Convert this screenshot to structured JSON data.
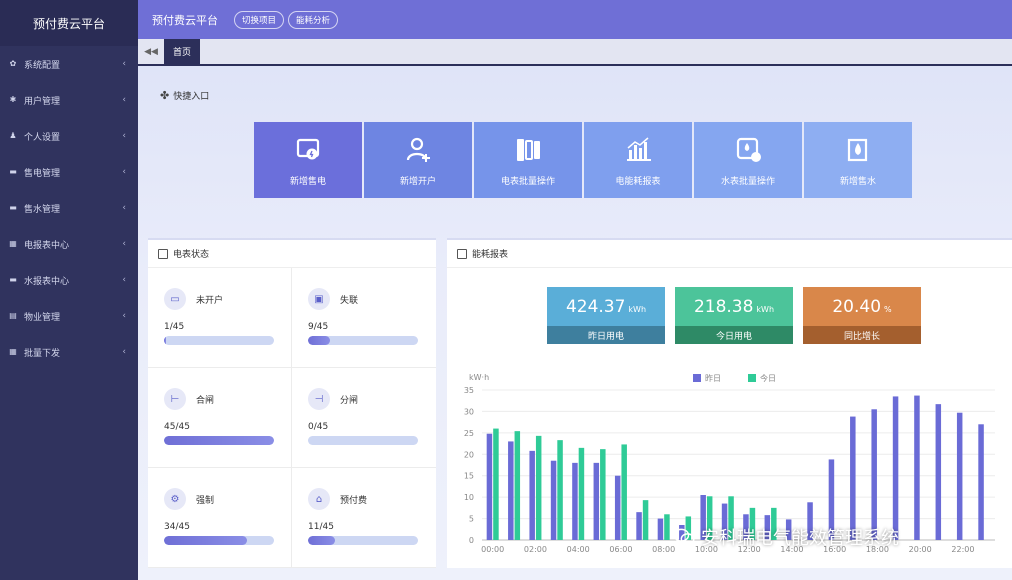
{
  "app": {
    "brand": "预付费云平台"
  },
  "header": {
    "title": "预付费云平台",
    "buttons": [
      "切换项目",
      "能耗分析"
    ]
  },
  "sidebar": {
    "items": [
      {
        "label": "系统配置",
        "icon": "gear-icon"
      },
      {
        "label": "用户管理",
        "icon": "asterisk-icon"
      },
      {
        "label": "个人设置",
        "icon": "person-icon"
      },
      {
        "label": "售电管理",
        "icon": "folder-icon"
      },
      {
        "label": "售水管理",
        "icon": "folder-icon"
      },
      {
        "label": "电报表中心",
        "icon": "grid-icon"
      },
      {
        "label": "水报表中心",
        "icon": "folder-icon"
      },
      {
        "label": "物业管理",
        "icon": "calendar-icon"
      },
      {
        "label": "批量下发",
        "icon": "grid-icon"
      }
    ]
  },
  "tabs": {
    "home": "首页"
  },
  "quick": {
    "title": "快捷入口",
    "cards": [
      {
        "label": "新增售电",
        "icon": "electric-sale-icon",
        "color": "#6b6fdb"
      },
      {
        "label": "新增开户",
        "icon": "add-user-icon",
        "color": "#6e85e2"
      },
      {
        "label": "电表批量操作",
        "icon": "meter-batch-icon",
        "color": "#7694ea"
      },
      {
        "label": "电能耗报表",
        "icon": "bar-report-icon",
        "color": "#7f9fee"
      },
      {
        "label": "水表批量操作",
        "icon": "water-meter-icon",
        "color": "#85a6f0"
      },
      {
        "label": "新增售水",
        "icon": "water-drop-icon",
        "color": "#8eaef2"
      }
    ]
  },
  "status": {
    "title": "电表状态",
    "items": [
      {
        "label": "未开户",
        "count": "1/45",
        "fraction": 0.022,
        "icon": "card-icon"
      },
      {
        "label": "失联",
        "count": "9/45",
        "fraction": 0.2,
        "icon": "meter-offline-icon"
      },
      {
        "label": "合闸",
        "count": "45/45",
        "fraction": 1.0,
        "icon": "switch-on-icon"
      },
      {
        "label": "分闸",
        "count": "0/45",
        "fraction": 0.0,
        "icon": "switch-off-icon"
      },
      {
        "label": "强制",
        "count": "34/45",
        "fraction": 0.756,
        "icon": "force-icon"
      },
      {
        "label": "预付费",
        "count": "11/45",
        "fraction": 0.244,
        "icon": "prepay-icon"
      }
    ]
  },
  "energy": {
    "title": "能耗报表",
    "kpis": [
      {
        "value": "424.37",
        "unit": "kWh",
        "label": "昨日用电",
        "color": "#5aaed8",
        "label_color": "#3e7f9e"
      },
      {
        "value": "218.38",
        "unit": "kWh",
        "label": "今日用电",
        "color": "#4cc49a",
        "label_color": "#2e8a66"
      },
      {
        "value": "20.40",
        "unit": "%",
        "label": "同比增长",
        "color": "#d9874a",
        "label_color": "#a45f2e"
      }
    ]
  },
  "chart_data": {
    "type": "bar",
    "ylabel": "kW·h",
    "ylim": [
      0,
      35
    ],
    "yticks": [
      0,
      5,
      10,
      15,
      20,
      25,
      30,
      35
    ],
    "x": [
      "00:00",
      "01:00",
      "02:00",
      "03:00",
      "04:00",
      "05:00",
      "06:00",
      "07:00",
      "08:00",
      "09:00",
      "10:00",
      "11:00",
      "12:00",
      "13:00",
      "14:00",
      "15:00",
      "16:00",
      "17:00",
      "18:00",
      "19:00",
      "20:00",
      "21:00",
      "22:00",
      "23:00"
    ],
    "xtick_labels": [
      "00:00",
      "02:00",
      "04:00",
      "06:00",
      "08:00",
      "10:00",
      "12:00",
      "14:00",
      "16:00",
      "18:00",
      "20:00",
      "22:00"
    ],
    "legend": "top-center",
    "grid": true,
    "series": [
      {
        "name": "昨日",
        "color": "#6a6bd6",
        "values": [
          24.8,
          23,
          20.8,
          18.5,
          18,
          18,
          15,
          6.5,
          5,
          3.5,
          10.5,
          8.5,
          6,
          5.8,
          4.8,
          8.8,
          18.8,
          28.8,
          30.5,
          33.5,
          33.7,
          31.7,
          29.7,
          27
        ]
      },
      {
        "name": "今日",
        "color": "#2fcb97",
        "values": [
          26,
          25.4,
          24.3,
          23.3,
          21.5,
          21.2,
          22.3,
          9.3,
          6,
          5.5,
          10.2,
          10.2,
          7.5,
          7.5,
          null,
          null,
          null,
          null,
          null,
          null,
          null,
          null,
          null,
          null
        ]
      }
    ]
  },
  "watermark": {
    "text": "安科瑞电气能效管理系统"
  }
}
